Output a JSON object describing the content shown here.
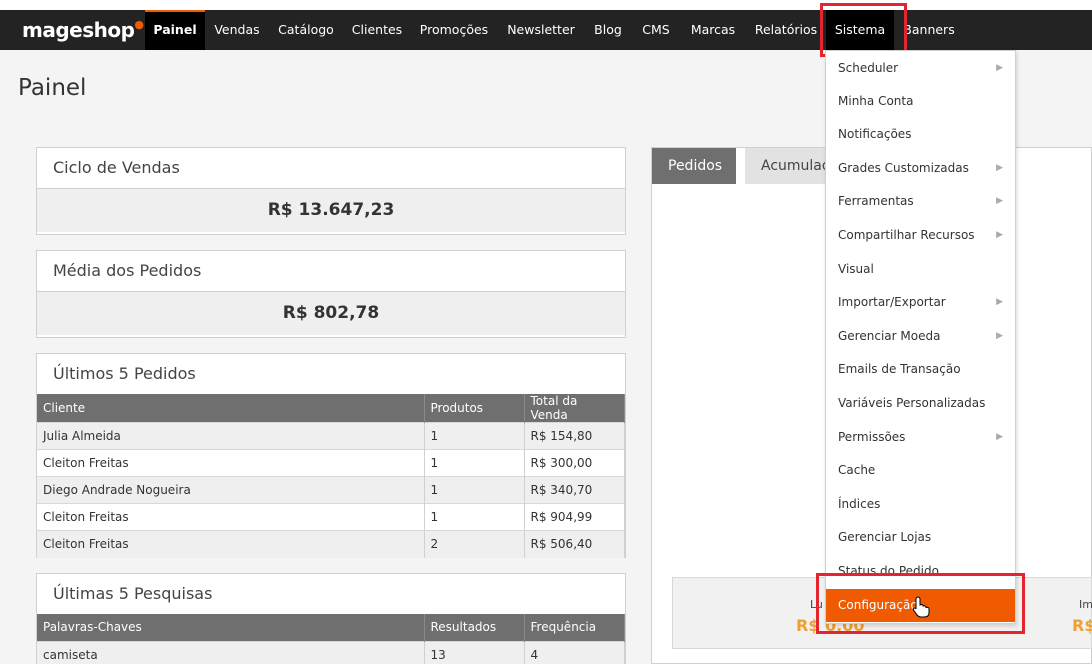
{
  "brand": {
    "name": "mageshop",
    "accent_color": "#f05a00"
  },
  "nav": {
    "items": [
      {
        "label": "Painel"
      },
      {
        "label": "Vendas"
      },
      {
        "label": "Catálogo"
      },
      {
        "label": "Clientes"
      },
      {
        "label": "Promoções"
      },
      {
        "label": "Newsletter"
      },
      {
        "label": "Blog"
      },
      {
        "label": "CMS"
      },
      {
        "label": "Marcas"
      },
      {
        "label": "Relatórios"
      },
      {
        "label": "Sistema"
      },
      {
        "label": "Banners"
      }
    ],
    "active": "Painel",
    "open_menu": "Sistema"
  },
  "page": {
    "title": "Painel"
  },
  "sales_cycle": {
    "title": "Ciclo de Vendas",
    "value": "R$ 13.647,23"
  },
  "avg_orders": {
    "title": "Média dos Pedidos",
    "value": "R$ 802,78"
  },
  "last_orders": {
    "title": "Últimos 5 Pedidos",
    "columns": [
      "Cliente",
      "Produtos",
      "Total da Venda"
    ],
    "rows": [
      [
        "Julia Almeida",
        "1",
        "R$ 154,80"
      ],
      [
        "Cleiton Freitas",
        "1",
        "R$ 300,00"
      ],
      [
        "Diego Andrade Nogueira",
        "1",
        "R$ 340,70"
      ],
      [
        "Cleiton Freitas",
        "1",
        "R$ 904,99"
      ],
      [
        "Cleiton Freitas",
        "2",
        "R$ 506,40"
      ]
    ]
  },
  "last_searches": {
    "title": "Últimas 5 Pesquisas",
    "columns": [
      "Palavras-Chaves",
      "Resultados",
      "Frequência"
    ],
    "rows": [
      [
        "camiseta",
        "13",
        "4"
      ]
    ]
  },
  "chart_tabs": {
    "tabs": [
      "Pedidos",
      "Acumulad"
    ]
  },
  "stats": {
    "left_label": "Lu",
    "left_value": "R$ 0,00",
    "right_label": "Im",
    "right_value": "R$"
  },
  "sistema_menu": {
    "items": [
      {
        "label": "Scheduler",
        "submenu": true
      },
      {
        "label": "Minha Conta",
        "submenu": false
      },
      {
        "label": "Notificações",
        "submenu": false
      },
      {
        "label": "Grades Customizadas",
        "submenu": true
      },
      {
        "label": "Ferramentas",
        "submenu": true
      },
      {
        "label": "Compartilhar Recursos",
        "submenu": true
      },
      {
        "label": "Visual",
        "submenu": false
      },
      {
        "label": "Importar/Exportar",
        "submenu": true
      },
      {
        "label": "Gerenciar Moeda",
        "submenu": true
      },
      {
        "label": "Emails de Transação",
        "submenu": false
      },
      {
        "label": "Variáveis Personalizadas",
        "submenu": false
      },
      {
        "label": "Permissões",
        "submenu": true
      },
      {
        "label": "Cache",
        "submenu": false
      },
      {
        "label": "Índices",
        "submenu": false
      },
      {
        "label": "Gerenciar Lojas",
        "submenu": false
      },
      {
        "label": "Status do Pedido",
        "submenu": false
      },
      {
        "label": "Configuração",
        "submenu": false
      }
    ],
    "selected": "Configuração"
  }
}
